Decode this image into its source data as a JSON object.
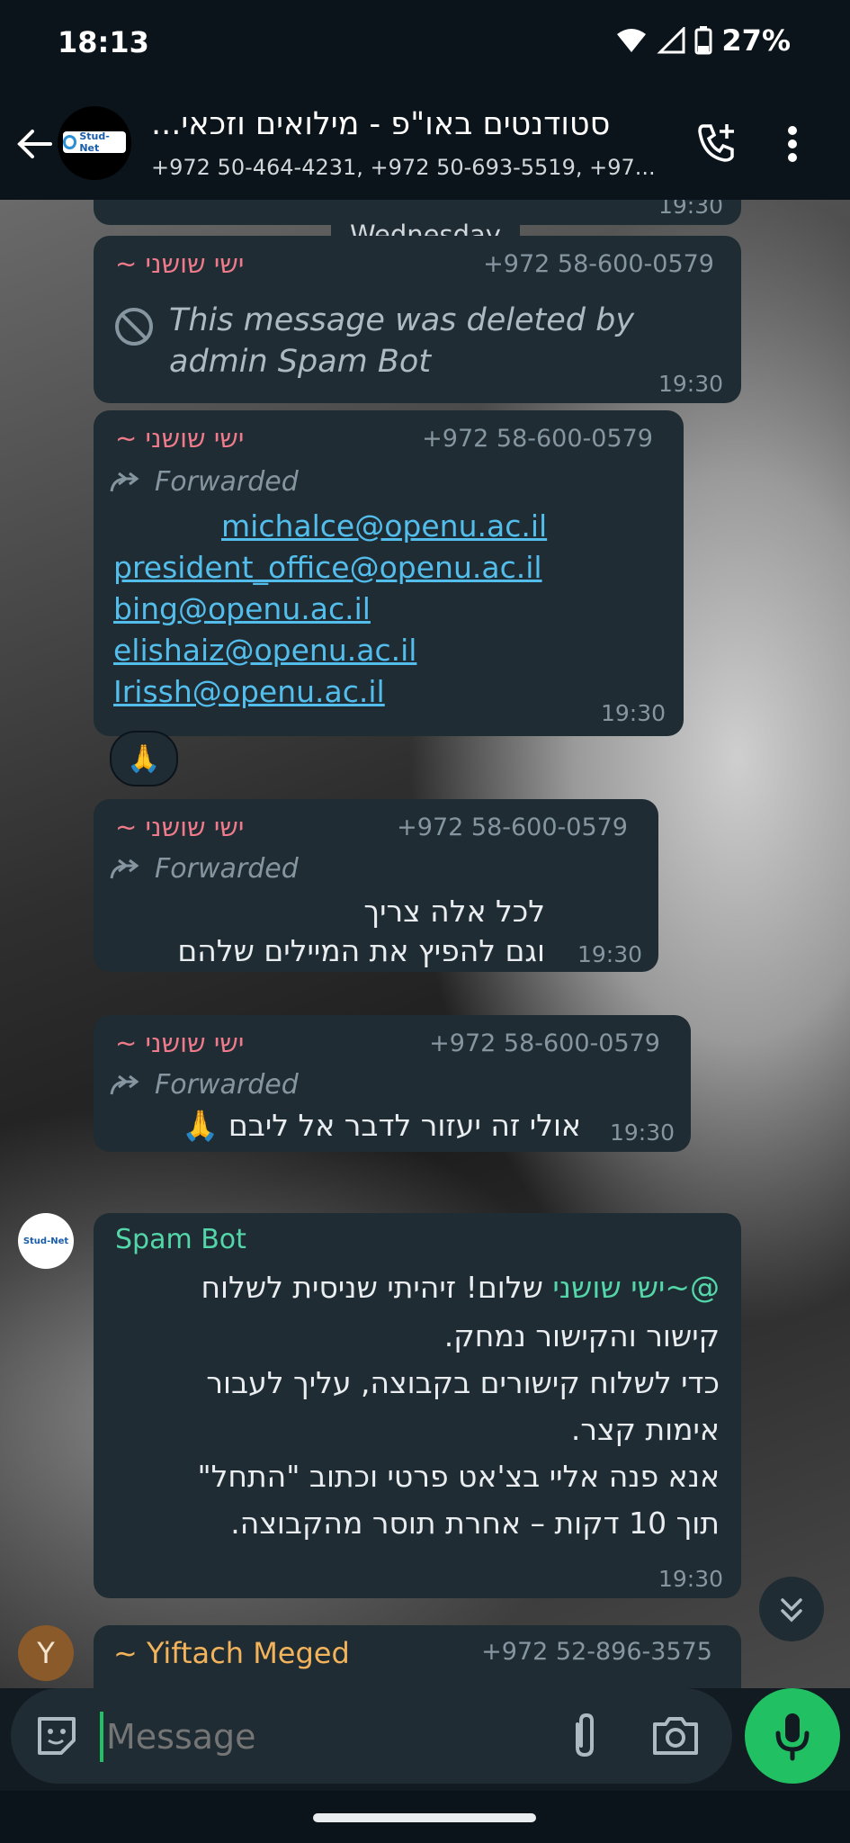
{
  "status_bar": {
    "time": "18:13",
    "battery": "27%"
  },
  "header": {
    "title": "סטודנטים באו\"פ - מילואים וזכאי...",
    "subtitle": "+972 50-464-4231, +972 50-693-5519, +97...",
    "avatar_text": "Stud-Net"
  },
  "chat": {
    "date_chip": "Wednesday",
    "top_time": "19:30",
    "msg1": {
      "sender": "ישי שושני ~",
      "phone": "+972 58-600-0579",
      "deleted_text_line1": "This message was deleted by",
      "deleted_text_line2": "admin Spam Bot",
      "time": "19:30"
    },
    "msg2": {
      "sender": "ישי שושני ~",
      "phone": "+972 58-600-0579",
      "forwarded": "Forwarded",
      "links": [
        "michalce@openu.ac.il",
        "president_office@openu.ac.il",
        "bing@openu.ac.il",
        "elishaiz@openu.ac.il",
        "Irissh@openu.ac.il"
      ],
      "time": "19:30",
      "reaction": "🙏"
    },
    "msg3": {
      "sender": "ישי שושני ~",
      "phone": "+972 58-600-0579",
      "forwarded": "Forwarded",
      "line1": "לכל אלה צריך",
      "line2": "וגם להפיץ את המיילים שלהם",
      "time": "19:30"
    },
    "msg4": {
      "sender": "ישי שושני ~",
      "phone": "+972 58-600-0579",
      "forwarded": "Forwarded",
      "text": "אולי זה יעזור לדבר אל ליבם 🙏",
      "time": "19:30"
    },
    "msg5": {
      "sender": "Spam Bot",
      "mention": "@~ישי שושני",
      "line1_rest": " שלום! זיהיתי שניסית לשלוח",
      "line2": "קישור והקישור נמחק.",
      "line3": "כדי לשלוח קישורים בקבוצה, עליך לעבור",
      "line4": "אימות קצר.",
      "line5": "אנא פנה אליי בצ'אט פרטי וכתוב \"התחל\"",
      "line6": "תוך 10 דקות – אחרת תוסר מהקבוצה.",
      "time": "19:30",
      "avatar_text": "Stud-Net"
    },
    "msg6": {
      "avatar_letter": "Y",
      "sender": "~ Yiftach Meged",
      "phone": "+972 52-896-3575"
    }
  },
  "input": {
    "placeholder": "Message"
  },
  "colors": {
    "accent": "#21c063",
    "link": "#53bdeb",
    "sender": "#ef7a8a",
    "bot_name": "#53d6a8",
    "yiftach": "#f2b35a"
  }
}
